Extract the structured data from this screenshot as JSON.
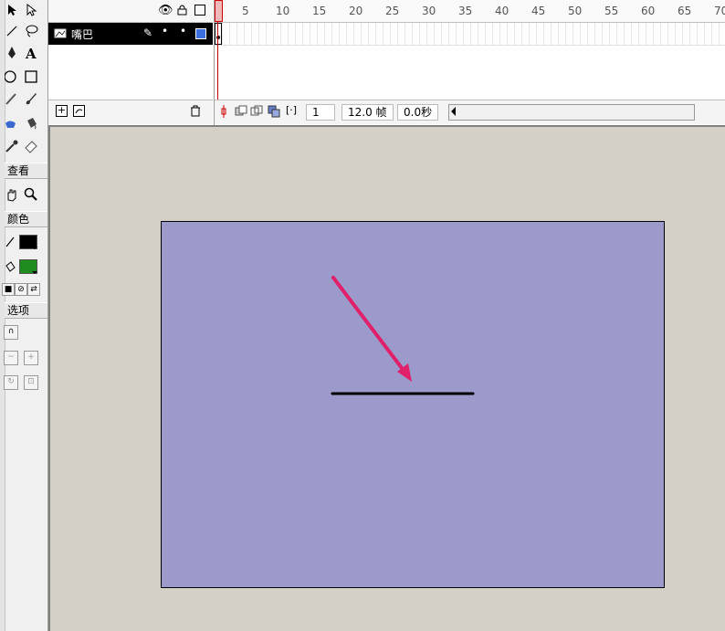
{
  "toolbar": {
    "sections": {
      "view": "查看",
      "colors": "颜色",
      "options": "选项"
    },
    "tools": [
      "arrow-icon",
      "subselect-icon",
      "line-icon",
      "lasso-icon",
      "pen-icon",
      "text-icon",
      "oval-icon",
      "rectangle-icon",
      "pencil-icon",
      "brush-icon",
      "ink-bottle-icon",
      "paint-bucket-icon",
      "eyedropper-icon",
      "eraser-icon",
      "hand-icon",
      "zoom-icon"
    ],
    "stroke_color": "#000000",
    "fill_color": "#1e8c1e"
  },
  "timeline": {
    "layer_name": "嘴巴",
    "layer_color": "#3b6fe0",
    "ticks": [
      "5",
      "10",
      "15",
      "20",
      "25",
      "30",
      "35",
      "40",
      "45",
      "50",
      "55",
      "60",
      "65",
      "70"
    ],
    "current_frame": "1",
    "frame_rate": "12.0 帧",
    "elapsed_time": "0.0秒"
  },
  "stage": {
    "background": "#9c9acb"
  }
}
